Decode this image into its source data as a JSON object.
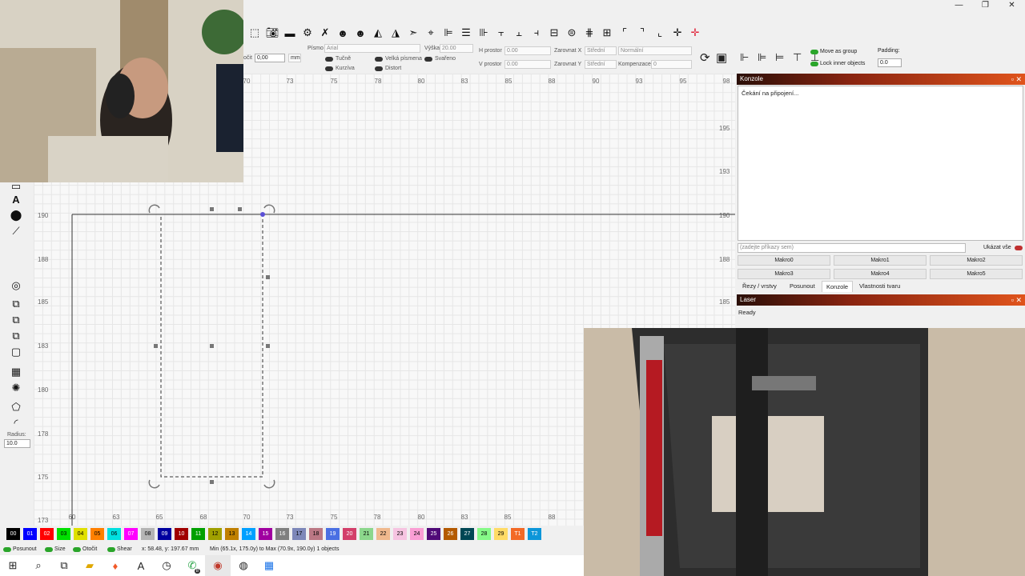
{
  "window_controls": [
    "—",
    "❐",
    "✕"
  ],
  "toolbar_icons": [
    "select-rect-icon",
    "camera-icon",
    "monitor-icon",
    "settings-icon",
    "tools-icon",
    "users-icon",
    "user-icon",
    "flip-icon",
    "mirror-icon",
    "send-icon",
    "target-icon",
    "align-left-icon",
    "align-center-icon",
    "align-right-icon",
    "align-top-icon",
    "align-middle-icon",
    "align-bottom-icon",
    "distribute-icon",
    "distribute-h-icon",
    "distribute-v-icon",
    "dist-a-icon",
    "dist-b-icon",
    "corner-tl-icon",
    "corner-tr-icon",
    "corner-bl-icon",
    "cross-icon",
    "cross-red-icon"
  ],
  "text_options": {
    "rotate_label": "očit",
    "rotate_value": "0,00",
    "unit": "mm",
    "font_label": "Písmo",
    "font_value": "Arial",
    "height_label": "Výška",
    "height_value": "20.00",
    "h_space_label": "H prostor",
    "h_space_value": "0.00",
    "v_space_label": "V prostor",
    "v_space_value": "0.00",
    "align_x_label": "Zarovnat X",
    "align_x_value": "Střední",
    "align_y_label": "Zarovnat Y",
    "align_y_value": "Střední",
    "mode_value": "Normální",
    "comp_label": "Kompenzace",
    "comp_value": "0",
    "bold": "Tučně",
    "italic": "Kurzíva",
    "caps": "Velká písmena",
    "distort": "Distort",
    "welded": "Svařeno"
  },
  "right_options": {
    "move_as_group": "Move as group",
    "lock_inner": "Lock inner objects",
    "padding_label": "Padding:",
    "padding_value": "0.0"
  },
  "ruler": {
    "top": [
      "70",
      "73",
      "75",
      "78",
      "80",
      "83",
      "85",
      "88",
      "90",
      "93",
      "95",
      "98"
    ],
    "bottom": [
      "60",
      "63",
      "65",
      "68",
      "70",
      "73",
      "75",
      "78",
      "80",
      "83",
      "85",
      "88"
    ],
    "left": [
      "190",
      "188",
      "185",
      "183",
      "180",
      "178",
      "175",
      "173"
    ],
    "right": [
      "195",
      "193",
      "190",
      "188",
      "185"
    ]
  },
  "left_tools": {
    "text_icon_glyph": "A",
    "radius_label": "Radius:",
    "radius_value": "10.0"
  },
  "console_panel": {
    "title": "Konzole",
    "content": "Čekání na připojení...",
    "command_placeholder": "(zadejte příkazy sem)",
    "show_all": "Ukázat vše",
    "macros": [
      "Makro0",
      "Makro1",
      "Makro2",
      "Makro3",
      "Makro4",
      "Makro5"
    ],
    "tabs": [
      "Řezy / vrstvy",
      "Posunout",
      "Konzole",
      "Vlastnosti tvaru"
    ]
  },
  "laser_panel": {
    "title": "Laser",
    "status": "Ready"
  },
  "palette": [
    {
      "label": "00",
      "color": "#000000",
      "text": "#ffffff"
    },
    {
      "label": "01",
      "color": "#0000ff",
      "text": "#ffffff"
    },
    {
      "label": "02",
      "color": "#ff0000",
      "text": "#ffffff"
    },
    {
      "label": "03",
      "color": "#00e000",
      "text": "#000000"
    },
    {
      "label": "04",
      "color": "#e0e000",
      "text": "#000000"
    },
    {
      "label": "05",
      "color": "#ff8000",
      "text": "#000000"
    },
    {
      "label": "06",
      "color": "#00e0e0",
      "text": "#000000"
    },
    {
      "label": "07",
      "color": "#ff00ff",
      "text": "#ffffff"
    },
    {
      "label": "08",
      "color": "#b4b4b4",
      "text": "#000000"
    },
    {
      "label": "09",
      "color": "#0000a0",
      "text": "#ffffff"
    },
    {
      "label": "10",
      "color": "#a00000",
      "text": "#ffffff"
    },
    {
      "label": "11",
      "color": "#00a000",
      "text": "#ffffff"
    },
    {
      "label": "12",
      "color": "#a0a000",
      "text": "#000000"
    },
    {
      "label": "13",
      "color": "#c08000",
      "text": "#000000"
    },
    {
      "label": "14",
      "color": "#00a0ff",
      "text": "#ffffff"
    },
    {
      "label": "15",
      "color": "#a000a0",
      "text": "#ffffff"
    },
    {
      "label": "16",
      "color": "#808080",
      "text": "#ffffff"
    },
    {
      "label": "17",
      "color": "#7d87b9",
      "text": "#000000"
    },
    {
      "label": "18",
      "color": "#bb7784",
      "text": "#000000"
    },
    {
      "label": "19",
      "color": "#4a6fe3",
      "text": "#ffffff"
    },
    {
      "label": "20",
      "color": "#d33f6a",
      "text": "#ffffff"
    },
    {
      "label": "21",
      "color": "#8cd78c",
      "text": "#000000"
    },
    {
      "label": "22",
      "color": "#f0b98d",
      "text": "#000000"
    },
    {
      "label": "23",
      "color": "#f6c4e1",
      "text": "#000000"
    },
    {
      "label": "24",
      "color": "#fa9ed4",
      "text": "#000000"
    },
    {
      "label": "25",
      "color": "#500a78",
      "text": "#ffffff"
    },
    {
      "label": "26",
      "color": "#b45a00",
      "text": "#ffffff"
    },
    {
      "label": "27",
      "color": "#004754",
      "text": "#ffffff"
    },
    {
      "label": "28",
      "color": "#86fa88",
      "text": "#000000"
    },
    {
      "label": "29",
      "color": "#ffdb66",
      "text": "#000000"
    },
    {
      "label": "T1",
      "color": "#f36926",
      "text": "#ffffff"
    },
    {
      "label": "T2",
      "color": "#0c96d9",
      "text": "#ffffff"
    }
  ],
  "status_bar": {
    "move": "Posunout",
    "size": "Size",
    "rotate": "Otočit",
    "shear": "Shear",
    "coords": "x: 58.48, y: 197.67 mm",
    "bounds": "Min (65.1x, 175.0y) to Max (70.9x, 190.0y)  1 objects"
  },
  "taskbar_icons": [
    "windows-icon",
    "search-icon",
    "task-view-icon",
    "file-explorer-icon",
    "brave-icon",
    "app-a-icon",
    "clock-app-icon",
    "whatsapp-icon",
    "lightburn-icon",
    "chrome-icon",
    "calculator-icon"
  ],
  "whatsapp_badge": "8"
}
